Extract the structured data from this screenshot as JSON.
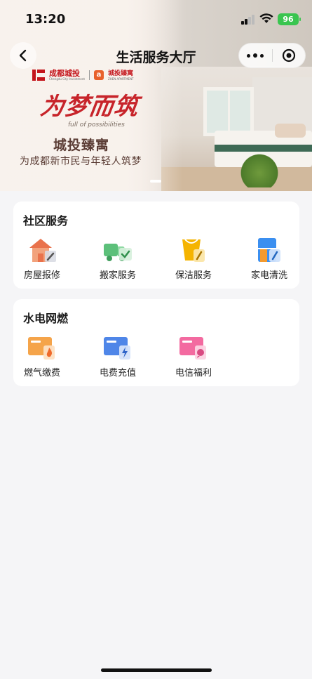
{
  "status_bar": {
    "time": "13:20",
    "battery": "96"
  },
  "navbar": {
    "title": "生活服务大厅"
  },
  "banner": {
    "brand_name": "成都城投",
    "brand_subtitle": "Chengdu City Investment",
    "brand2_name": "城投臻寓",
    "brand2_subtitle": "ZHEN APARTMENT",
    "slogan": "为梦而筑",
    "slogan_en": "full of possibilities",
    "headline": "城投臻寓",
    "subline": "为成都新市民与年轻人筑梦"
  },
  "sections": [
    {
      "title": "社区服务",
      "items": [
        {
          "label": "房屋报修",
          "icon": "house-repair-icon"
        },
        {
          "label": "搬家服务",
          "icon": "moving-truck-icon"
        },
        {
          "label": "保洁服务",
          "icon": "cleaning-bucket-icon"
        },
        {
          "label": "家电清洗",
          "icon": "appliance-cleaning-icon"
        }
      ]
    },
    {
      "title": "水电网燃",
      "items": [
        {
          "label": "燃气缴费",
          "icon": "gas-flame-icon"
        },
        {
          "label": "电费充值",
          "icon": "electricity-bolt-icon"
        },
        {
          "label": "电信福利",
          "icon": "telecom-chat-icon"
        }
      ]
    }
  ],
  "colors": {
    "accent_red": "#c4161c",
    "battery_green": "#39c54f",
    "page_bg": "#f5f5f7"
  }
}
